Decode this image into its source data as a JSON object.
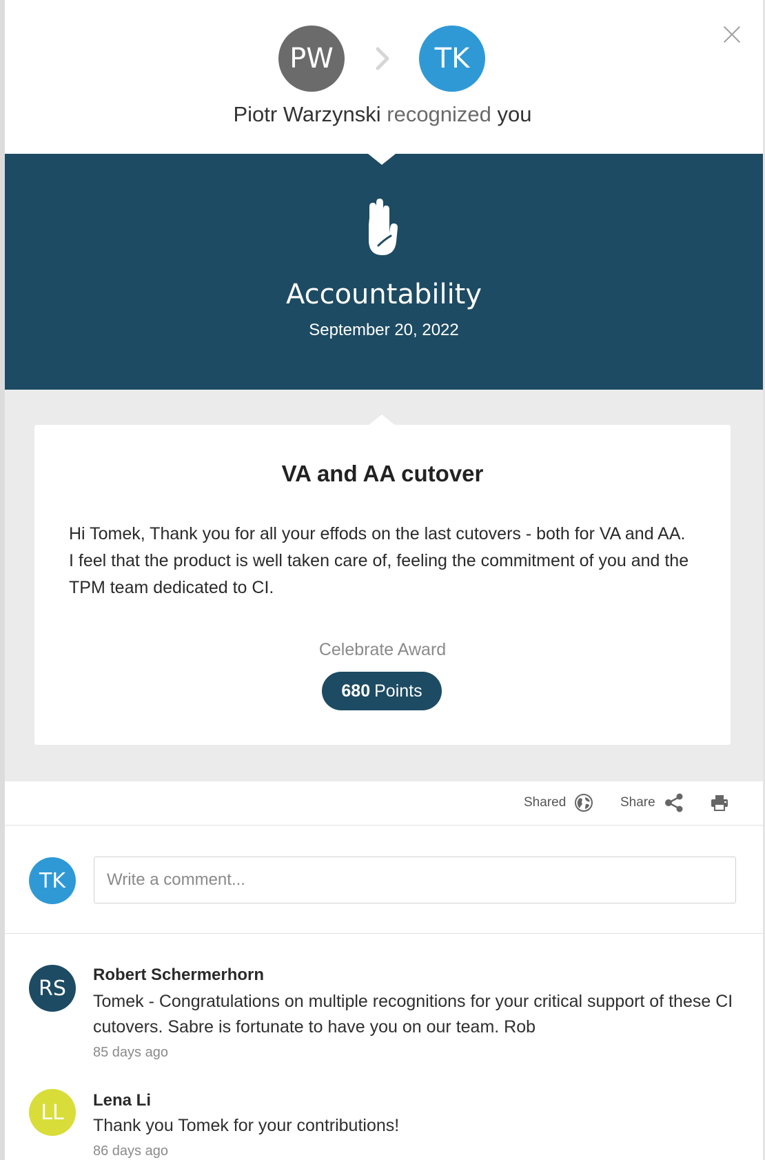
{
  "header": {
    "giver_initials": "PW",
    "receiver_initials": "TK",
    "giver_name": "Piotr Warzynski",
    "verb": "recognized",
    "object": "you"
  },
  "recognition": {
    "value": "Accountability",
    "date": "September 20, 2022",
    "icon": "raised-hand-icon"
  },
  "card": {
    "title": "VA and AA cutover",
    "message": "Hi Tomek, Thank you for all your effods on the last cutovers - both for VA and AA. I feel that the product is well taken care of, feeling the commitment of you and the TPM team dedicated to CI.",
    "award_label": "Celebrate Award",
    "points_value": "680",
    "points_unit": "Points"
  },
  "actions": {
    "shared_label": "Shared",
    "share_label": "Share"
  },
  "comment_box": {
    "avatar_initials": "TK",
    "placeholder": "Write a comment..."
  },
  "comments": [
    {
      "initials": "RS",
      "name": "Robert Schermerhorn",
      "text": "Tomek - Congratulations on multiple recognitions for your critical support of these CI cutovers. Sabre is fortunate to have you on our team. Rob",
      "time": "85 days ago"
    },
    {
      "initials": "LL",
      "name": "Lena Li",
      "text": "Thank you Tomek for your contributions!",
      "time": "86 days ago"
    }
  ],
  "colors": {
    "banner": "#1d4b63",
    "receiver_avatar": "#2f99d6",
    "giver_avatar": "#6b6b6b",
    "ll_avatar": "#d9dd3a"
  }
}
